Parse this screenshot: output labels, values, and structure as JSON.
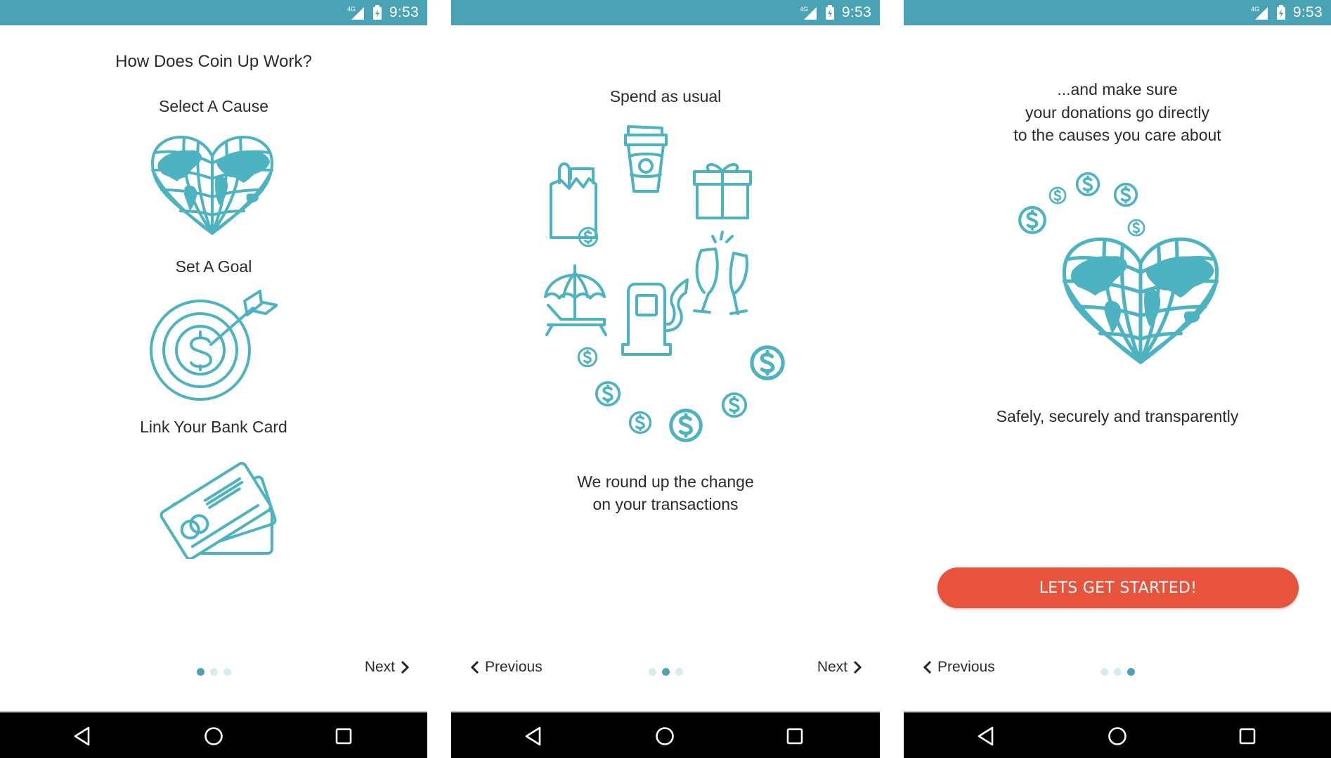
{
  "status_bar": {
    "time": "9:53",
    "network": "4G",
    "icons": [
      "signal-icon",
      "battery-charging-icon"
    ]
  },
  "colors": {
    "accent": "#4aa3b5",
    "illustration": "#4db3c1",
    "cta": "#e8533b",
    "dot_inactive": "#d7ecef",
    "text": "#2b2b2b"
  },
  "screens": [
    {
      "title": "How Does Coin Up Work?",
      "steps": [
        {
          "label": "Select A Cause",
          "icon": "heart-globe-icon"
        },
        {
          "label": "Set A Goal",
          "icon": "target-dollar-icon"
        },
        {
          "label": "Link Your Bank Card",
          "icon": "bank-cards-icon"
        }
      ],
      "page_index": 1,
      "page_count": 3,
      "next_label": "Next"
    },
    {
      "heading": "Spend as usual",
      "icons": [
        "grocery-bag-icon",
        "coffee-cup-icon",
        "gift-icon",
        "beach-umbrella-icon",
        "gas-pump-icon",
        "champagne-glasses-icon",
        "coins-icon"
      ],
      "caption_line1": "We round up the change",
      "caption_line2": "on your transactions",
      "page_index": 2,
      "page_count": 3,
      "previous_label": "Previous",
      "next_label": "Next"
    },
    {
      "heading_line1": "...and make sure",
      "heading_line2": "your donations go directly",
      "heading_line3": "to the causes you care about",
      "icons": [
        "coins-icon",
        "heart-globe-icon"
      ],
      "caption": "Safely, securely and transparently",
      "cta_label": "LETS GET STARTED!",
      "page_index": 3,
      "page_count": 3,
      "previous_label": "Previous"
    }
  ],
  "system_nav": {
    "back": "back-icon",
    "home": "home-icon",
    "recents": "recents-icon"
  }
}
